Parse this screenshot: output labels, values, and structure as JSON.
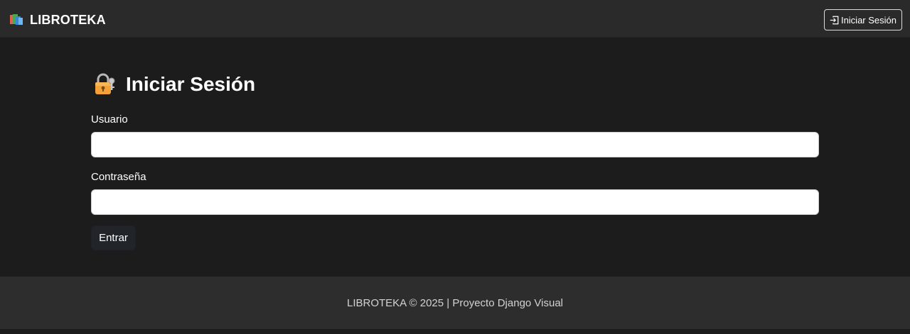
{
  "navbar": {
    "brand_text": "LIBROTEKA",
    "brand_icon": "books-icon",
    "login_button_label": "Iniciar Sesión",
    "login_button_icon": "sign-in-icon"
  },
  "main": {
    "title": "Iniciar Sesión",
    "title_icon": "lock-key-icon",
    "username_label": "Usuario",
    "username_value": "",
    "password_label": "Contraseña",
    "password_value": "",
    "submit_label": "Entrar"
  },
  "footer": {
    "text": "LIBROTEKA © 2025 | Proyecto Django Visual"
  },
  "colors": {
    "navbar_bg": "#2a2a2a",
    "page_bg": "#1c1c1c",
    "footer_bg": "#2d2d2d",
    "submit_bg": "#212529"
  }
}
